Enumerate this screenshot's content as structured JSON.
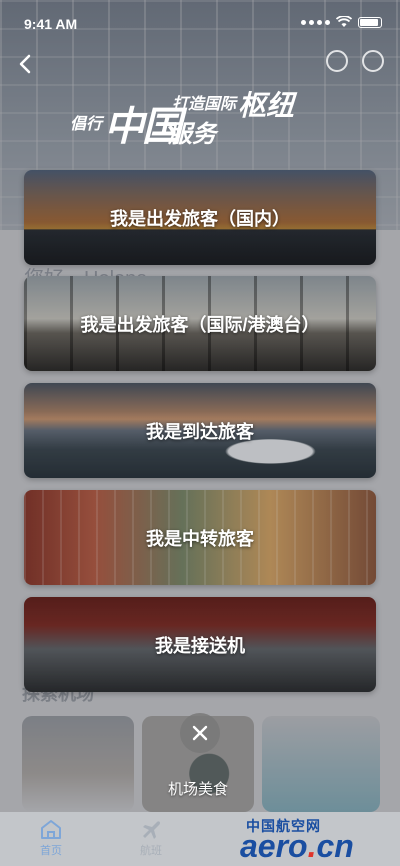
{
  "status_bar": {
    "time": "9:41 AM"
  },
  "slogan": {
    "left": "倡行",
    "big1": "中国",
    "big2": "服务",
    "right_small": "打造国际",
    "big3": "枢纽"
  },
  "underlay": {
    "greeting": "您好，Helena",
    "explore": "探索机场",
    "tile_caption": "机场美食"
  },
  "options": [
    {
      "label": "我是出发旅客（国内）"
    },
    {
      "label": "我是出发旅客（国际/港澳台）"
    },
    {
      "label": "我是到达旅客"
    },
    {
      "label": "我是中转旅客"
    },
    {
      "label": "我是接送机"
    }
  ],
  "tab_bar": {
    "home": "首页",
    "flight": "航班"
  },
  "watermark": {
    "cn": "中国航空网",
    "en_main": "aero",
    "en_dot": ".",
    "en_tld": "cn"
  },
  "colors": {
    "tab_active": "#7ea6d8",
    "watermark_blue": "#1a4ea1",
    "watermark_red": "#e0342b"
  }
}
